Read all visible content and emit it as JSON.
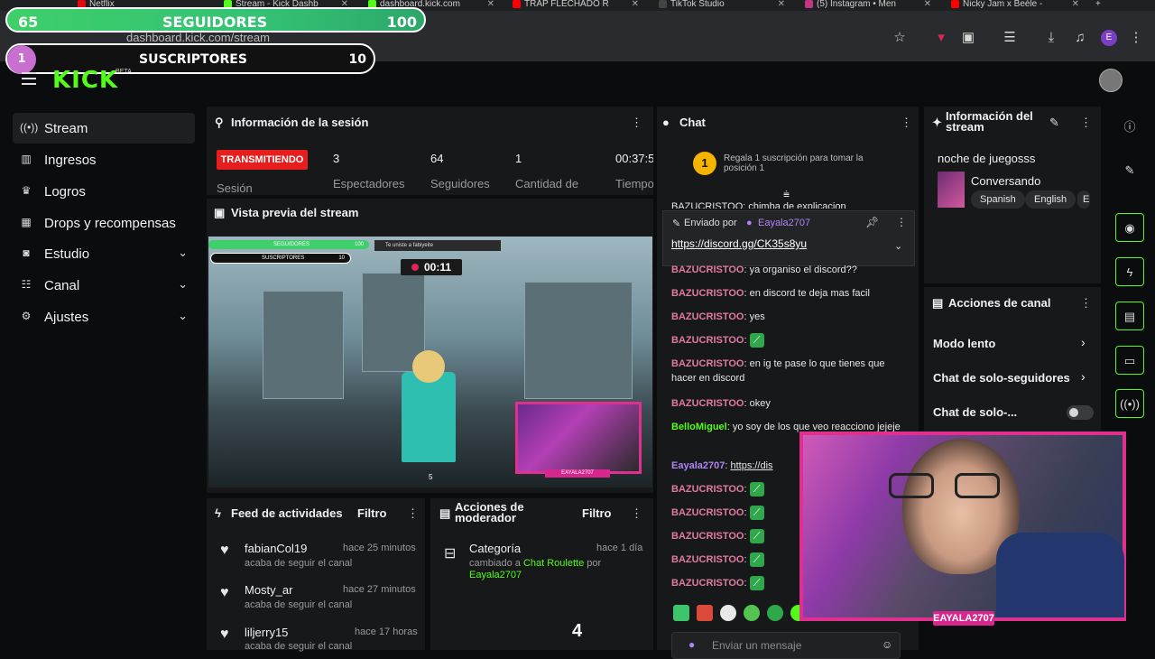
{
  "overlay": {
    "followers": {
      "count": "65",
      "label": "SEGUIDORES",
      "goal": "100"
    },
    "subs": {
      "count": "1",
      "label": "SUSCRIPTORES",
      "goal": "10"
    }
  },
  "browser": {
    "tabs": [
      {
        "label": "Netflix",
        "color": "#e50914"
      },
      {
        "label": "Stream - Kick Dashb",
        "color": "#53fc18"
      },
      {
        "label": "dashboard.kick.com",
        "color": "#53fc18"
      },
      {
        "label": "TRAP FLECHADO R",
        "color": "#ff0000"
      },
      {
        "label": "TikTok Studio",
        "color": "#222222"
      },
      {
        "label": "(5) Instagram • Men",
        "color": "#c13584"
      },
      {
        "label": "Nicky Jam x Beéle -",
        "color": "#ff0000"
      }
    ],
    "url": "dashboard.kick.com/stream"
  },
  "header": {
    "logo": "KICK",
    "beta": "BETA"
  },
  "nav": [
    {
      "label": "Stream",
      "icon": "broadcast-icon"
    },
    {
      "label": "Ingresos",
      "icon": "chart-icon"
    },
    {
      "label": "Logros",
      "icon": "trophy-icon"
    },
    {
      "label": "Drops y recompensas",
      "icon": "gift-icon"
    },
    {
      "label": "Estudio",
      "icon": "studio-icon"
    },
    {
      "label": "Canal",
      "icon": "channel-icon"
    },
    {
      "label": "Ajustes",
      "icon": "gear-icon"
    }
  ],
  "session": {
    "title": "Información de la sesión",
    "live": "TRANSMITIENDO",
    "live_label": "Sesión",
    "stats": [
      {
        "value": "3",
        "label": "Espectadores"
      },
      {
        "value": "64",
        "label": "Seguidores"
      },
      {
        "value": "1",
        "label": "Cantidad de"
      },
      {
        "value": "00:37:5",
        "label": "Tiempo"
      }
    ]
  },
  "preview": {
    "title": "Vista previa del stream",
    "timer": "00:11",
    "mini_followers": "SEGUIDORES",
    "mini_followers_goal": "100",
    "mini_subs": "SUSCRIPTORES",
    "mini_subs_goal": "10",
    "mini_notice": "Te uniste a fabiyeite",
    "mini_cam_label": "EAYALA2707",
    "page_num": "5"
  },
  "feed": {
    "title": "Feed de actividades",
    "filter": "Filtro",
    "items": [
      {
        "name": "fabianCol19",
        "time": "hace 25 minutos",
        "sub": "acaba de seguir el canal"
      },
      {
        "name": "Mosty_ar",
        "time": "hace 27 minutos",
        "sub": "acaba de seguir el canal"
      },
      {
        "name": "liljerry15",
        "time": "hace 17 horas",
        "sub": "acaba de seguir el canal"
      }
    ]
  },
  "modactions": {
    "title_line1": "Acciones de",
    "title_line2": "moderador",
    "filter": "Filtro",
    "item": {
      "title": "Categoría",
      "time": "hace 1 día",
      "prefix": "cambiado a",
      "category": "Chat Roulette",
      "by": "por",
      "user": "Eayala2707"
    },
    "page_num": "4"
  },
  "chat": {
    "title": "Chat",
    "gift_count": "1",
    "gift_text": "Regala 1 suscripción para tomar la posición 1",
    "pinned_by_label": "Enviado por",
    "pinned_user": "Eayala2707",
    "pinned_link": "https://discord.gg/CK35s8yu",
    "partial": "BAZUCRISTOO: chimba de explicacion",
    "messages": [
      {
        "user": "BAZUCRISTOO",
        "text": "ya organiso el discord??",
        "color": "pink"
      },
      {
        "user": "BAZUCRISTOO",
        "text": "en discord te deja mas facil",
        "color": "pink"
      },
      {
        "user": "BAZUCRISTOO",
        "text": "yes",
        "color": "pink"
      },
      {
        "user": "BAZUCRISTOO",
        "text": "",
        "emote": true,
        "color": "pink"
      },
      {
        "user": "BAZUCRISTOO",
        "text": "en ig te pase lo que tienes que hacer en discord",
        "color": "pink"
      },
      {
        "user": "BAZUCRISTOO",
        "text": "okey",
        "color": "pink"
      },
      {
        "user": "BelloMiguel",
        "text": "yo soy de los que veo reacciono jejeje",
        "color": "green"
      },
      {
        "user": "Eayala2707",
        "text": "https://dis",
        "color": "purple"
      },
      {
        "user": "BAZUCRISTOO",
        "text": "",
        "emote": true,
        "color": "pink"
      },
      {
        "user": "BAZUCRISTOO",
        "text": "",
        "emote": true,
        "color": "pink"
      },
      {
        "user": "BAZUCRISTOO",
        "text": "",
        "emote": true,
        "color": "pink"
      },
      {
        "user": "BAZUCRISTOO",
        "text": "",
        "emote": true,
        "color": "pink"
      },
      {
        "user": "BAZUCRISTOO",
        "text": "",
        "emote": true,
        "color": "pink"
      }
    ],
    "input_placeholder": "Enviar un mensaje"
  },
  "streaminfo": {
    "title_line1": "Información del",
    "title_line2": "stream",
    "stream_title": "noche de juegosss",
    "category": "Conversando",
    "tags": [
      "Spanish",
      "English",
      "E"
    ]
  },
  "channel_actions": {
    "title": "Acciones de canal",
    "items": [
      {
        "label": "Modo lento",
        "type": "arrow"
      },
      {
        "label": "Chat de solo-seguidores",
        "type": "arrow"
      },
      {
        "label": "Chat de solo-...",
        "type": "toggle"
      }
    ]
  },
  "webcam": {
    "label": "EAYALA2707"
  },
  "colors": {
    "kick_green": "#53fc18",
    "live_red": "#e61e1e",
    "cam_pink": "#e0308f"
  }
}
